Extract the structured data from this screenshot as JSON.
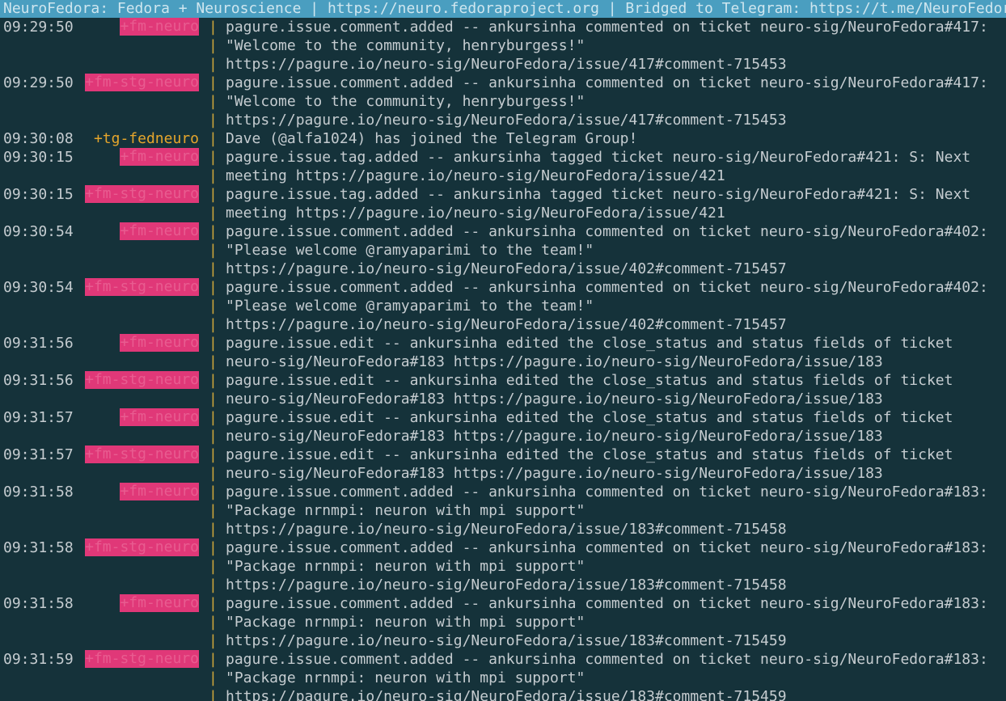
{
  "window": {
    "topic": "NeuroFedora: Fedora + Neuroscience | https://neuro.fedoraproject.org | Bridged to Telegram: https://t.me/NeuroFedora"
  },
  "separator": "|",
  "colors": {
    "background": "#15323a",
    "topic_bar": "#4a9ec0",
    "highlight_nick_bg": "#e03878",
    "join_nick": "#e6a62c",
    "separator": "#d0a73a",
    "text": "#c5ccd0"
  },
  "messages": [
    {
      "time": "09:29:50",
      "nick": "+fm-neuro",
      "style": "hl",
      "lines": [
        "pagure.issue.comment.added -- ankursinha commented on ticket neuro-sig/NeuroFedora#417:",
        "\"Welcome to the community, henryburgess!\"",
        "https://pagure.io/neuro-sig/NeuroFedora/issue/417#comment-715453"
      ]
    },
    {
      "time": "09:29:50",
      "nick": "+fm-stg-neuro",
      "style": "hl",
      "lines": [
        "pagure.issue.comment.added -- ankursinha commented on ticket neuro-sig/NeuroFedora#417:",
        "\"Welcome to the community, henryburgess!\"",
        "https://pagure.io/neuro-sig/NeuroFedora/issue/417#comment-715453"
      ]
    },
    {
      "time": "09:30:08",
      "nick": "+tg-fedneuro",
      "style": "join",
      "lines": [
        "Dave (@alfa1024) has joined the Telegram Group!"
      ]
    },
    {
      "time": "09:30:15",
      "nick": "+fm-neuro",
      "style": "hl",
      "lines": [
        "pagure.issue.tag.added -- ankursinha tagged ticket neuro-sig/NeuroFedora#421: S: Next",
        "meeting https://pagure.io/neuro-sig/NeuroFedora/issue/421"
      ]
    },
    {
      "time": "09:30:15",
      "nick": "+fm-stg-neuro",
      "style": "hl",
      "lines": [
        "pagure.issue.tag.added -- ankursinha tagged ticket neuro-sig/NeuroFedora#421: S: Next",
        "meeting https://pagure.io/neuro-sig/NeuroFedora/issue/421"
      ]
    },
    {
      "time": "09:30:54",
      "nick": "+fm-neuro",
      "style": "hl",
      "lines": [
        "pagure.issue.comment.added -- ankursinha commented on ticket neuro-sig/NeuroFedora#402:",
        "\"Please welcome @ramyaparimi to the team!\"",
        "https://pagure.io/neuro-sig/NeuroFedora/issue/402#comment-715457"
      ]
    },
    {
      "time": "09:30:54",
      "nick": "+fm-stg-neuro",
      "style": "hl",
      "lines": [
        "pagure.issue.comment.added -- ankursinha commented on ticket neuro-sig/NeuroFedora#402:",
        "\"Please welcome @ramyaparimi to the team!\"",
        "https://pagure.io/neuro-sig/NeuroFedora/issue/402#comment-715457"
      ]
    },
    {
      "time": "09:31:56",
      "nick": "+fm-neuro",
      "style": "hl",
      "lines": [
        "pagure.issue.edit -- ankursinha edited the close_status and status fields of ticket",
        "neuro-sig/NeuroFedora#183 https://pagure.io/neuro-sig/NeuroFedora/issue/183"
      ]
    },
    {
      "time": "09:31:56",
      "nick": "+fm-stg-neuro",
      "style": "hl",
      "lines": [
        "pagure.issue.edit -- ankursinha edited the close_status and status fields of ticket",
        "neuro-sig/NeuroFedora#183 https://pagure.io/neuro-sig/NeuroFedora/issue/183"
      ]
    },
    {
      "time": "09:31:57",
      "nick": "+fm-neuro",
      "style": "hl",
      "lines": [
        "pagure.issue.edit -- ankursinha edited the close_status and status fields of ticket",
        "neuro-sig/NeuroFedora#183 https://pagure.io/neuro-sig/NeuroFedora/issue/183"
      ]
    },
    {
      "time": "09:31:57",
      "nick": "+fm-stg-neuro",
      "style": "hl",
      "lines": [
        "pagure.issue.edit -- ankursinha edited the close_status and status fields of ticket",
        "neuro-sig/NeuroFedora#183 https://pagure.io/neuro-sig/NeuroFedora/issue/183"
      ]
    },
    {
      "time": "09:31:58",
      "nick": "+fm-neuro",
      "style": "hl",
      "lines": [
        "pagure.issue.comment.added -- ankursinha commented on ticket neuro-sig/NeuroFedora#183:",
        "\"Package nrnmpi: neuron with mpi support\"",
        "https://pagure.io/neuro-sig/NeuroFedora/issue/183#comment-715458"
      ]
    },
    {
      "time": "09:31:58",
      "nick": "+fm-stg-neuro",
      "style": "hl",
      "lines": [
        "pagure.issue.comment.added -- ankursinha commented on ticket neuro-sig/NeuroFedora#183:",
        "\"Package nrnmpi: neuron with mpi support\"",
        "https://pagure.io/neuro-sig/NeuroFedora/issue/183#comment-715458"
      ]
    },
    {
      "time": "09:31:58",
      "nick": "+fm-neuro",
      "style": "hl",
      "lines": [
        "pagure.issue.comment.added -- ankursinha commented on ticket neuro-sig/NeuroFedora#183:",
        "\"Package nrnmpi: neuron with mpi support\"",
        "https://pagure.io/neuro-sig/NeuroFedora/issue/183#comment-715459"
      ]
    },
    {
      "time": "09:31:59",
      "nick": "+fm-stg-neuro",
      "style": "hl",
      "lines": [
        "pagure.issue.comment.added -- ankursinha commented on ticket neuro-sig/NeuroFedora#183:",
        "\"Package nrnmpi: neuron with mpi support\"",
        "https://pagure.io/neuro-sig/NeuroFedora/issue/183#comment-715459"
      ]
    }
  ]
}
